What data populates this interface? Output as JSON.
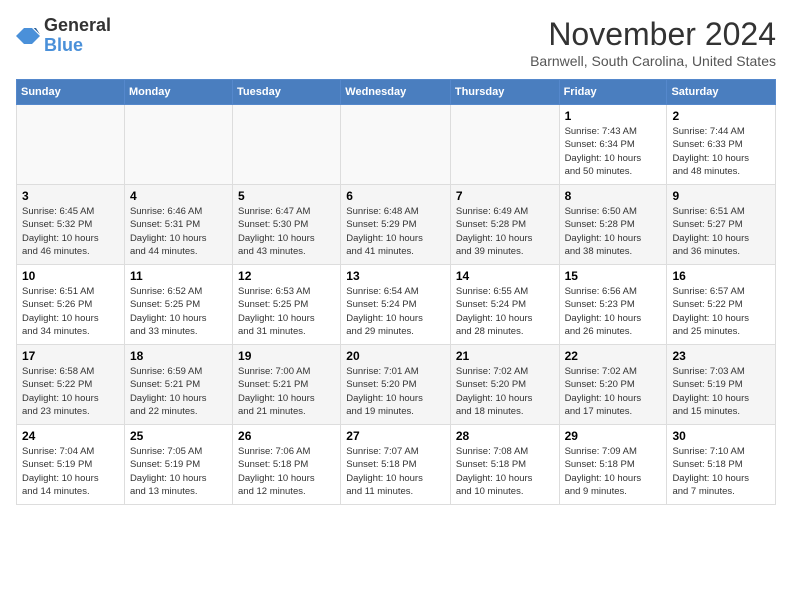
{
  "header": {
    "logo_line1": "General",
    "logo_line2": "Blue",
    "month": "November 2024",
    "location": "Barnwell, South Carolina, United States"
  },
  "days_of_week": [
    "Sunday",
    "Monday",
    "Tuesday",
    "Wednesday",
    "Thursday",
    "Friday",
    "Saturday"
  ],
  "weeks": [
    [
      {
        "day": "",
        "info": ""
      },
      {
        "day": "",
        "info": ""
      },
      {
        "day": "",
        "info": ""
      },
      {
        "day": "",
        "info": ""
      },
      {
        "day": "",
        "info": ""
      },
      {
        "day": "1",
        "info": "Sunrise: 7:43 AM\nSunset: 6:34 PM\nDaylight: 10 hours\nand 50 minutes."
      },
      {
        "day": "2",
        "info": "Sunrise: 7:44 AM\nSunset: 6:33 PM\nDaylight: 10 hours\nand 48 minutes."
      }
    ],
    [
      {
        "day": "3",
        "info": "Sunrise: 6:45 AM\nSunset: 5:32 PM\nDaylight: 10 hours\nand 46 minutes."
      },
      {
        "day": "4",
        "info": "Sunrise: 6:46 AM\nSunset: 5:31 PM\nDaylight: 10 hours\nand 44 minutes."
      },
      {
        "day": "5",
        "info": "Sunrise: 6:47 AM\nSunset: 5:30 PM\nDaylight: 10 hours\nand 43 minutes."
      },
      {
        "day": "6",
        "info": "Sunrise: 6:48 AM\nSunset: 5:29 PM\nDaylight: 10 hours\nand 41 minutes."
      },
      {
        "day": "7",
        "info": "Sunrise: 6:49 AM\nSunset: 5:28 PM\nDaylight: 10 hours\nand 39 minutes."
      },
      {
        "day": "8",
        "info": "Sunrise: 6:50 AM\nSunset: 5:28 PM\nDaylight: 10 hours\nand 38 minutes."
      },
      {
        "day": "9",
        "info": "Sunrise: 6:51 AM\nSunset: 5:27 PM\nDaylight: 10 hours\nand 36 minutes."
      }
    ],
    [
      {
        "day": "10",
        "info": "Sunrise: 6:51 AM\nSunset: 5:26 PM\nDaylight: 10 hours\nand 34 minutes."
      },
      {
        "day": "11",
        "info": "Sunrise: 6:52 AM\nSunset: 5:25 PM\nDaylight: 10 hours\nand 33 minutes."
      },
      {
        "day": "12",
        "info": "Sunrise: 6:53 AM\nSunset: 5:25 PM\nDaylight: 10 hours\nand 31 minutes."
      },
      {
        "day": "13",
        "info": "Sunrise: 6:54 AM\nSunset: 5:24 PM\nDaylight: 10 hours\nand 29 minutes."
      },
      {
        "day": "14",
        "info": "Sunrise: 6:55 AM\nSunset: 5:24 PM\nDaylight: 10 hours\nand 28 minutes."
      },
      {
        "day": "15",
        "info": "Sunrise: 6:56 AM\nSunset: 5:23 PM\nDaylight: 10 hours\nand 26 minutes."
      },
      {
        "day": "16",
        "info": "Sunrise: 6:57 AM\nSunset: 5:22 PM\nDaylight: 10 hours\nand 25 minutes."
      }
    ],
    [
      {
        "day": "17",
        "info": "Sunrise: 6:58 AM\nSunset: 5:22 PM\nDaylight: 10 hours\nand 23 minutes."
      },
      {
        "day": "18",
        "info": "Sunrise: 6:59 AM\nSunset: 5:21 PM\nDaylight: 10 hours\nand 22 minutes."
      },
      {
        "day": "19",
        "info": "Sunrise: 7:00 AM\nSunset: 5:21 PM\nDaylight: 10 hours\nand 21 minutes."
      },
      {
        "day": "20",
        "info": "Sunrise: 7:01 AM\nSunset: 5:20 PM\nDaylight: 10 hours\nand 19 minutes."
      },
      {
        "day": "21",
        "info": "Sunrise: 7:02 AM\nSunset: 5:20 PM\nDaylight: 10 hours\nand 18 minutes."
      },
      {
        "day": "22",
        "info": "Sunrise: 7:02 AM\nSunset: 5:20 PM\nDaylight: 10 hours\nand 17 minutes."
      },
      {
        "day": "23",
        "info": "Sunrise: 7:03 AM\nSunset: 5:19 PM\nDaylight: 10 hours\nand 15 minutes."
      }
    ],
    [
      {
        "day": "24",
        "info": "Sunrise: 7:04 AM\nSunset: 5:19 PM\nDaylight: 10 hours\nand 14 minutes."
      },
      {
        "day": "25",
        "info": "Sunrise: 7:05 AM\nSunset: 5:19 PM\nDaylight: 10 hours\nand 13 minutes."
      },
      {
        "day": "26",
        "info": "Sunrise: 7:06 AM\nSunset: 5:18 PM\nDaylight: 10 hours\nand 12 minutes."
      },
      {
        "day": "27",
        "info": "Sunrise: 7:07 AM\nSunset: 5:18 PM\nDaylight: 10 hours\nand 11 minutes."
      },
      {
        "day": "28",
        "info": "Sunrise: 7:08 AM\nSunset: 5:18 PM\nDaylight: 10 hours\nand 10 minutes."
      },
      {
        "day": "29",
        "info": "Sunrise: 7:09 AM\nSunset: 5:18 PM\nDaylight: 10 hours\nand 9 minutes."
      },
      {
        "day": "30",
        "info": "Sunrise: 7:10 AM\nSunset: 5:18 PM\nDaylight: 10 hours\nand 7 minutes."
      }
    ]
  ]
}
